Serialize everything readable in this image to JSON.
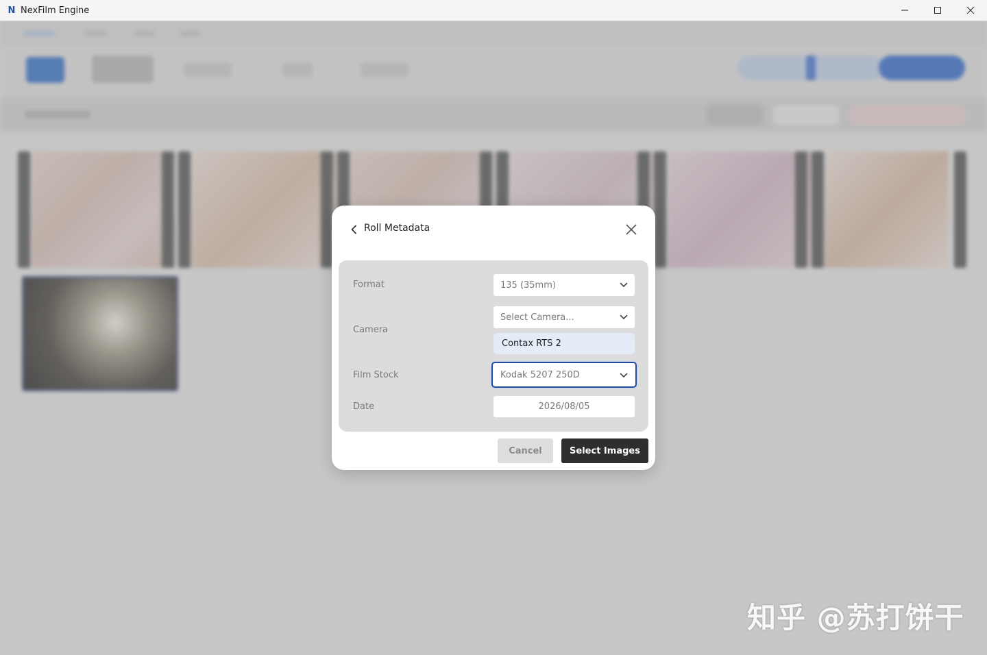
{
  "window": {
    "title": "NexFilm Engine",
    "logo_letter": "N"
  },
  "dialog": {
    "title": "Roll Metadata",
    "fields": {
      "format": {
        "label": "Format",
        "value": "135 (35mm)"
      },
      "camera": {
        "label": "Camera",
        "placeholder": "Select Camera...",
        "selected_chip": "Contax RTS 2"
      },
      "film_stock": {
        "label": "Film Stock",
        "value": "Kodak 5207 250D"
      },
      "date": {
        "label": "Date",
        "value": "2026/08/05"
      }
    },
    "buttons": {
      "cancel": "Cancel",
      "confirm": "Select Images"
    }
  },
  "watermark": "知乎 @苏打饼干",
  "colors": {
    "accent": "#1e4aa0",
    "primary_button": "#2e2e2e",
    "panel": "#dcdcdc",
    "chip": "#e4ecf8"
  }
}
